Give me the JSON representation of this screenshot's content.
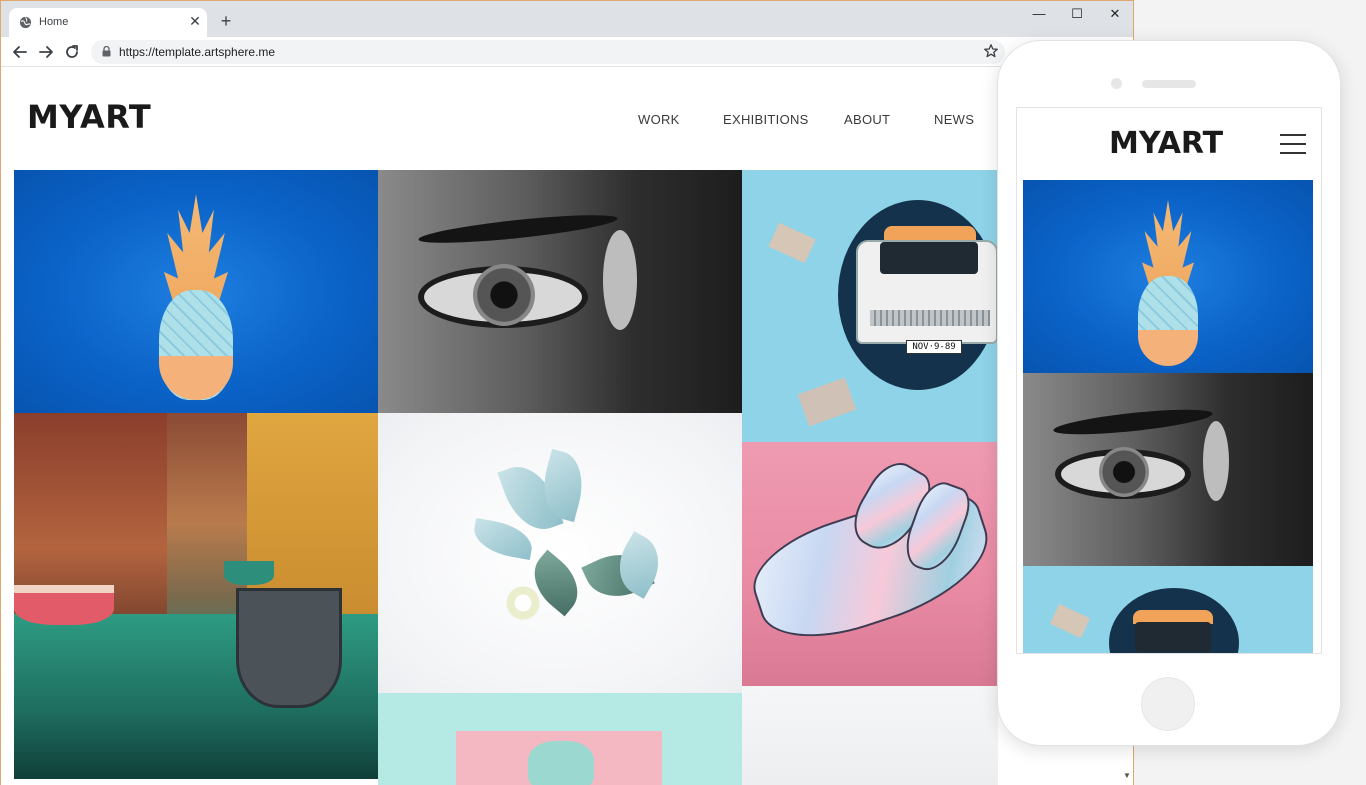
{
  "browser": {
    "tab_title": "Home",
    "new_tab_glyph": "+",
    "close_tab_glyph": "✕",
    "window_controls": {
      "minimize": "—",
      "maximize": "☐",
      "close": "✕"
    },
    "url": "https://template.artsphere.me"
  },
  "site": {
    "logo": "MYART",
    "nav": [
      "WORK",
      "EXHIBITIONS",
      "ABOUT",
      "NEWS"
    ]
  },
  "tiles": [
    {
      "icon": "pineapple-artwork",
      "plate": ""
    },
    {
      "icon": "eye-mural-artwork",
      "plate": ""
    },
    {
      "icon": "car-wall-artwork",
      "plate": "NOV·9-89"
    },
    {
      "icon": "venice-canal-artwork",
      "plate": ""
    },
    {
      "icon": "flower-artwork",
      "plate": ""
    },
    {
      "icon": "painted-hand-artwork",
      "plate": ""
    },
    {
      "icon": "mint-cat-artwork",
      "plate": ""
    },
    {
      "icon": "white-artwork",
      "plate": ""
    }
  ],
  "phone": {
    "logo": "MYART",
    "menu_icon": "hamburger-icon"
  },
  "colors": {
    "browser_chrome": "#dee1e6",
    "window_border": "#e0a86a",
    "omnibox": "#f1f3f4",
    "logo_text": "#1a1a1a"
  }
}
